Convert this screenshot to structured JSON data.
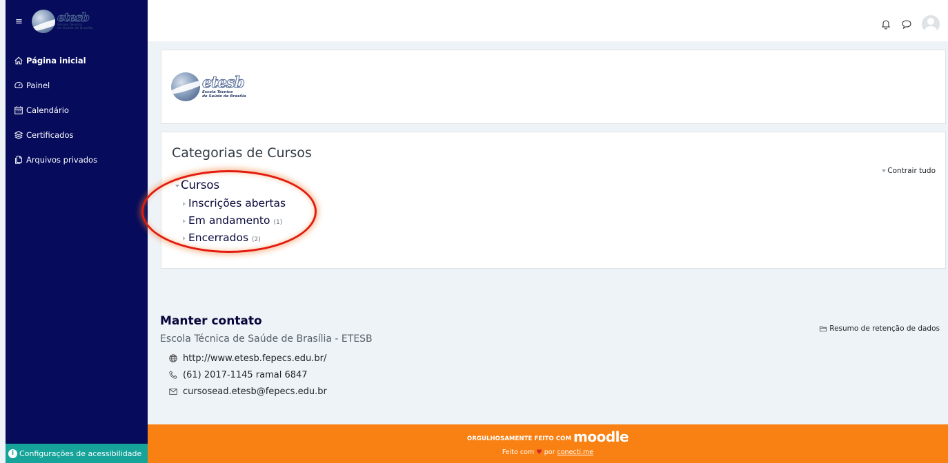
{
  "colors": {
    "sidebar_bg": "#060b5c",
    "footer_bg": "#f98012",
    "accessibility_bg": "#15a39a",
    "highlight": "#e31b0f"
  },
  "logo": {
    "word": "etesb",
    "sub_line1": "Escola Técnica",
    "sub_line2": "de Saúde de Brasília"
  },
  "header": {
    "icons": [
      "bell-icon",
      "chat-bubble-icon",
      "user-avatar"
    ]
  },
  "sidebar": {
    "menu_icon": "≡",
    "items": [
      {
        "label": "Página inicial",
        "icon": "home-icon",
        "active": true
      },
      {
        "label": "Painel",
        "icon": "dashboard-icon",
        "active": false
      },
      {
        "label": "Calendário",
        "icon": "calendar-icon",
        "active": false
      },
      {
        "label": "Certificados",
        "icon": "layers-icon",
        "active": false
      },
      {
        "label": "Arquivos privados",
        "icon": "files-icon",
        "active": false
      }
    ],
    "accessibility_label": "Configurações de acessibilidade"
  },
  "categories": {
    "title": "Categorias de Cursos",
    "collapse_all": "Contrair tudo",
    "root": "Cursos",
    "children": [
      {
        "name": "Inscrições abertas",
        "count": ""
      },
      {
        "name": "Em andamento",
        "count": "(1)"
      },
      {
        "name": "Encerrados",
        "count": "(2)"
      }
    ]
  },
  "contact": {
    "title": "Manter contato",
    "org": "Escola Técnica de Saúde de Brasília - ETESB",
    "website": "http://www.etesb.fepecs.edu.br/",
    "phone": "(61) 2017-1145 ramal 6847",
    "email": "cursosead.etesb@fepecs.edu.br",
    "retention": "Resumo de retenção de dados"
  },
  "footer": {
    "made_with": "ORGULHOSAMENTE FEITO COM",
    "moodle": "moodle",
    "made_by_prefix": "Feito com",
    "made_by_mid": "por",
    "made_by_link": "conecti.me"
  }
}
